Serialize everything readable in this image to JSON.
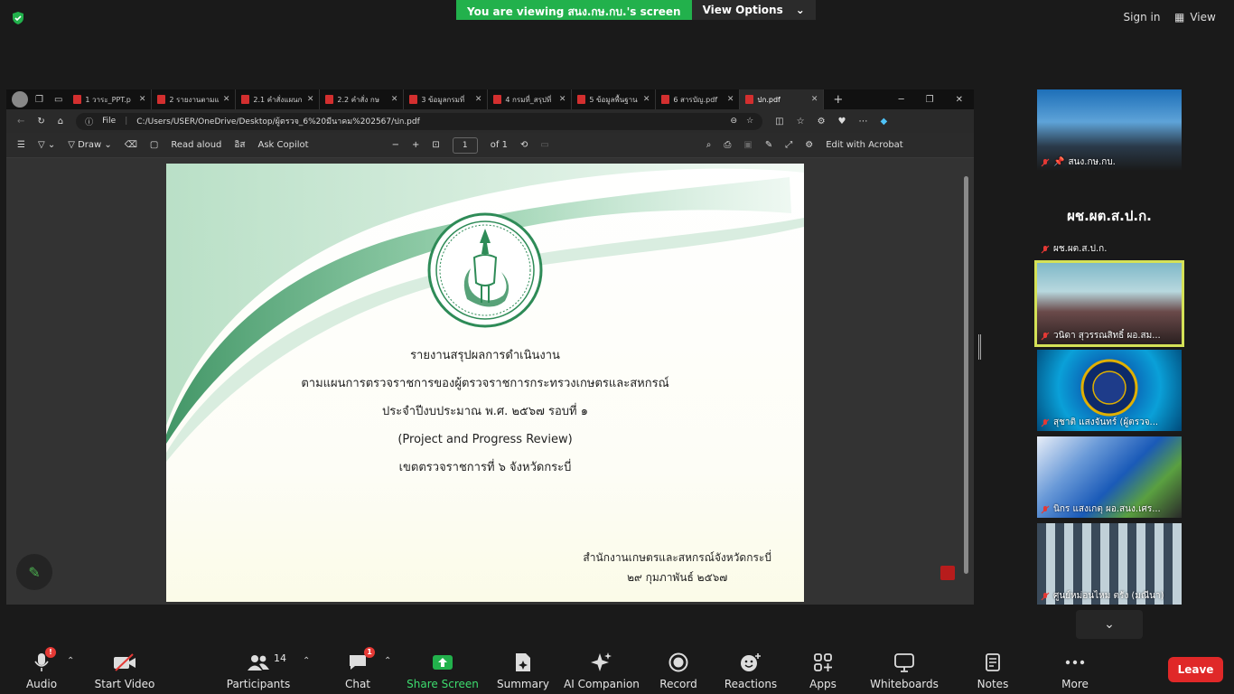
{
  "top": {
    "viewing_text": "You are viewing สนง.กษ.กบ.'s screen",
    "view_options": "View Options",
    "sign_in": "Sign in",
    "view": "View"
  },
  "browser": {
    "tabs": [
      {
        "label": "1 วาระ_PPT.p",
        "active": false
      },
      {
        "label": "2 รายงานตามแ",
        "active": false
      },
      {
        "label": "2.1 คำสั่งแผนก",
        "active": false
      },
      {
        "label": "2.2 คำสั่ง กษ",
        "active": false
      },
      {
        "label": "3 ข้อมูลกรมที่",
        "active": false
      },
      {
        "label": "4 กรมที่_สรุปที่",
        "active": false
      },
      {
        "label": "5 ข้อมูลพื้นฐาน",
        "active": false
      },
      {
        "label": "6 สารบัญ.pdf",
        "active": false
      },
      {
        "label": "ปก.pdf",
        "active": true
      }
    ],
    "file_label": "File",
    "url": "C:/Users/USER/OneDrive/Desktop/ผู้ตรวจ_6%20มีนาคม%202567/ปก.pdf",
    "toolbar": {
      "draw": "Draw",
      "read_aloud": "Read aloud",
      "translate": "อิส",
      "ask_copilot": "Ask Copilot",
      "page_number": "1",
      "page_of": "of 1",
      "edit_acrobat": "Edit with Acrobat"
    }
  },
  "document": {
    "lines": [
      "รายงานสรุปผลการดำเนินงาน",
      "ตามแผนการตรวจราชการของผู้ตรวจราชการกระทรวงเกษตรและสหกรณ์",
      "ประจำปีงบประมาณ พ.ศ. ๒๕๖๗ รอบที่ ๑",
      "(Project and Progress Review)",
      "เขตตรวจราชการที่ ๖ จังหวัดกระบี่"
    ],
    "footer": [
      "สำนักงานเกษตรและสหกรณ์จังหวัดกระบี่",
      "๒๙ กุมภาพันธ์ ๒๕๖๗"
    ],
    "theme_green": "#2e8b57"
  },
  "participants_tiles": [
    {
      "name": "สนง.กษ.กบ.",
      "pinned": true
    },
    {
      "name": "ผช.ผต.ส.ป.ก.",
      "big_name": "ผช.ผต.ส.ป.ก."
    },
    {
      "name": "วนิดา สุวรรณสิทธิ์ ผอ.สม...",
      "active": true
    },
    {
      "name": "สุชาติ แสงจันทร์ (ผู้ตรวจ..."
    },
    {
      "name": "นิกร แสงเกตุ ผอ.สนง.เศร..."
    },
    {
      "name": "ศูนย์หม่อนไหม ตรัง (มณีนา)"
    }
  ],
  "controls": {
    "audio": "Audio",
    "audio_badge": "!",
    "start_video": "Start Video",
    "participants": "Participants",
    "participants_count": "14",
    "chat": "Chat",
    "chat_badge": "1",
    "share_screen": "Share Screen",
    "summary": "Summary",
    "ai_companion": "AI Companion",
    "record": "Record",
    "reactions": "Reactions",
    "apps": "Apps",
    "whiteboards": "Whiteboards",
    "notes": "Notes",
    "more": "More",
    "leave": "Leave"
  },
  "colors": {
    "share_green": "#22b14c",
    "leave_red": "#e02828",
    "active_speaker": "#d4e157"
  }
}
